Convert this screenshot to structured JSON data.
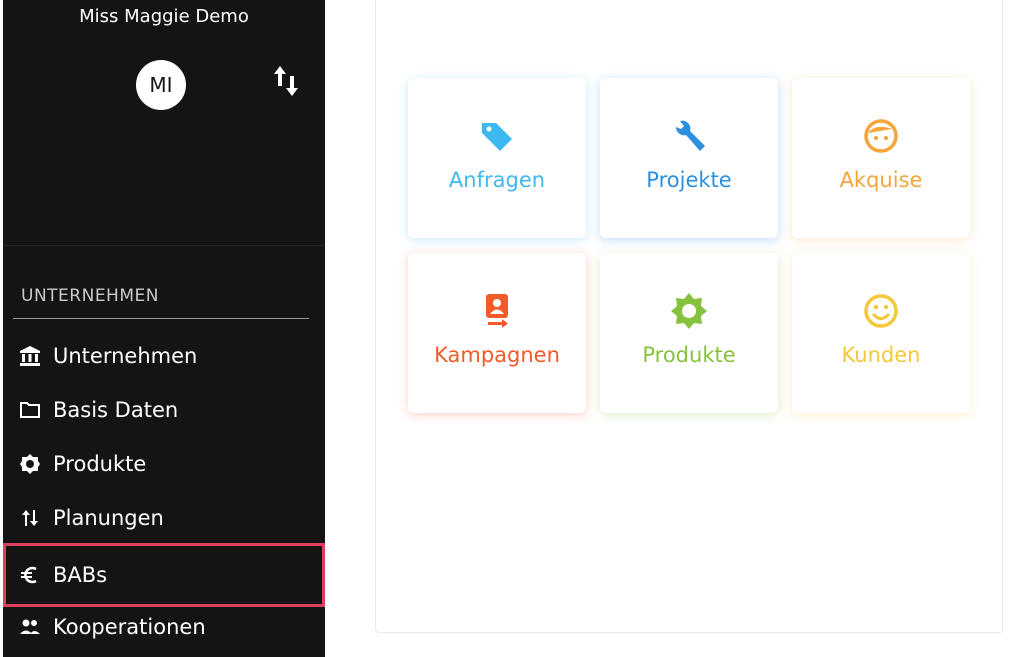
{
  "sidebar": {
    "company_name": "Miss Maggie Demo",
    "avatar_initials": "MI",
    "section_title": "UNTERNEHMEN",
    "items": [
      {
        "label": "Unternehmen",
        "icon": "bank-icon"
      },
      {
        "label": "Basis Daten",
        "icon": "folder-icon"
      },
      {
        "label": "Produkte",
        "icon": "gear-icon"
      },
      {
        "label": "Planungen",
        "icon": "swap-icon"
      },
      {
        "label": "BABs",
        "icon": "euro-icon"
      },
      {
        "label": "Kooperationen",
        "icon": "people-icon"
      }
    ]
  },
  "tiles": [
    {
      "label": "Anfragen",
      "icon": "tag-icon",
      "color": "#3db8f0"
    },
    {
      "label": "Projekte",
      "icon": "wrench-icon",
      "color": "#2d8fe0"
    },
    {
      "label": "Akquise",
      "icon": "face-icon",
      "color": "#f5a53a"
    },
    {
      "label": "Kampagnen",
      "icon": "badge-icon",
      "color": "#f25a2a"
    },
    {
      "label": "Produkte",
      "icon": "sun-gear-icon",
      "color": "#86c23e"
    },
    {
      "label": "Kunden",
      "icon": "smiley-icon",
      "color": "#f5c83a"
    }
  ],
  "colors": {
    "sidebar_bg": "#141414",
    "highlight": "#e0405e"
  }
}
